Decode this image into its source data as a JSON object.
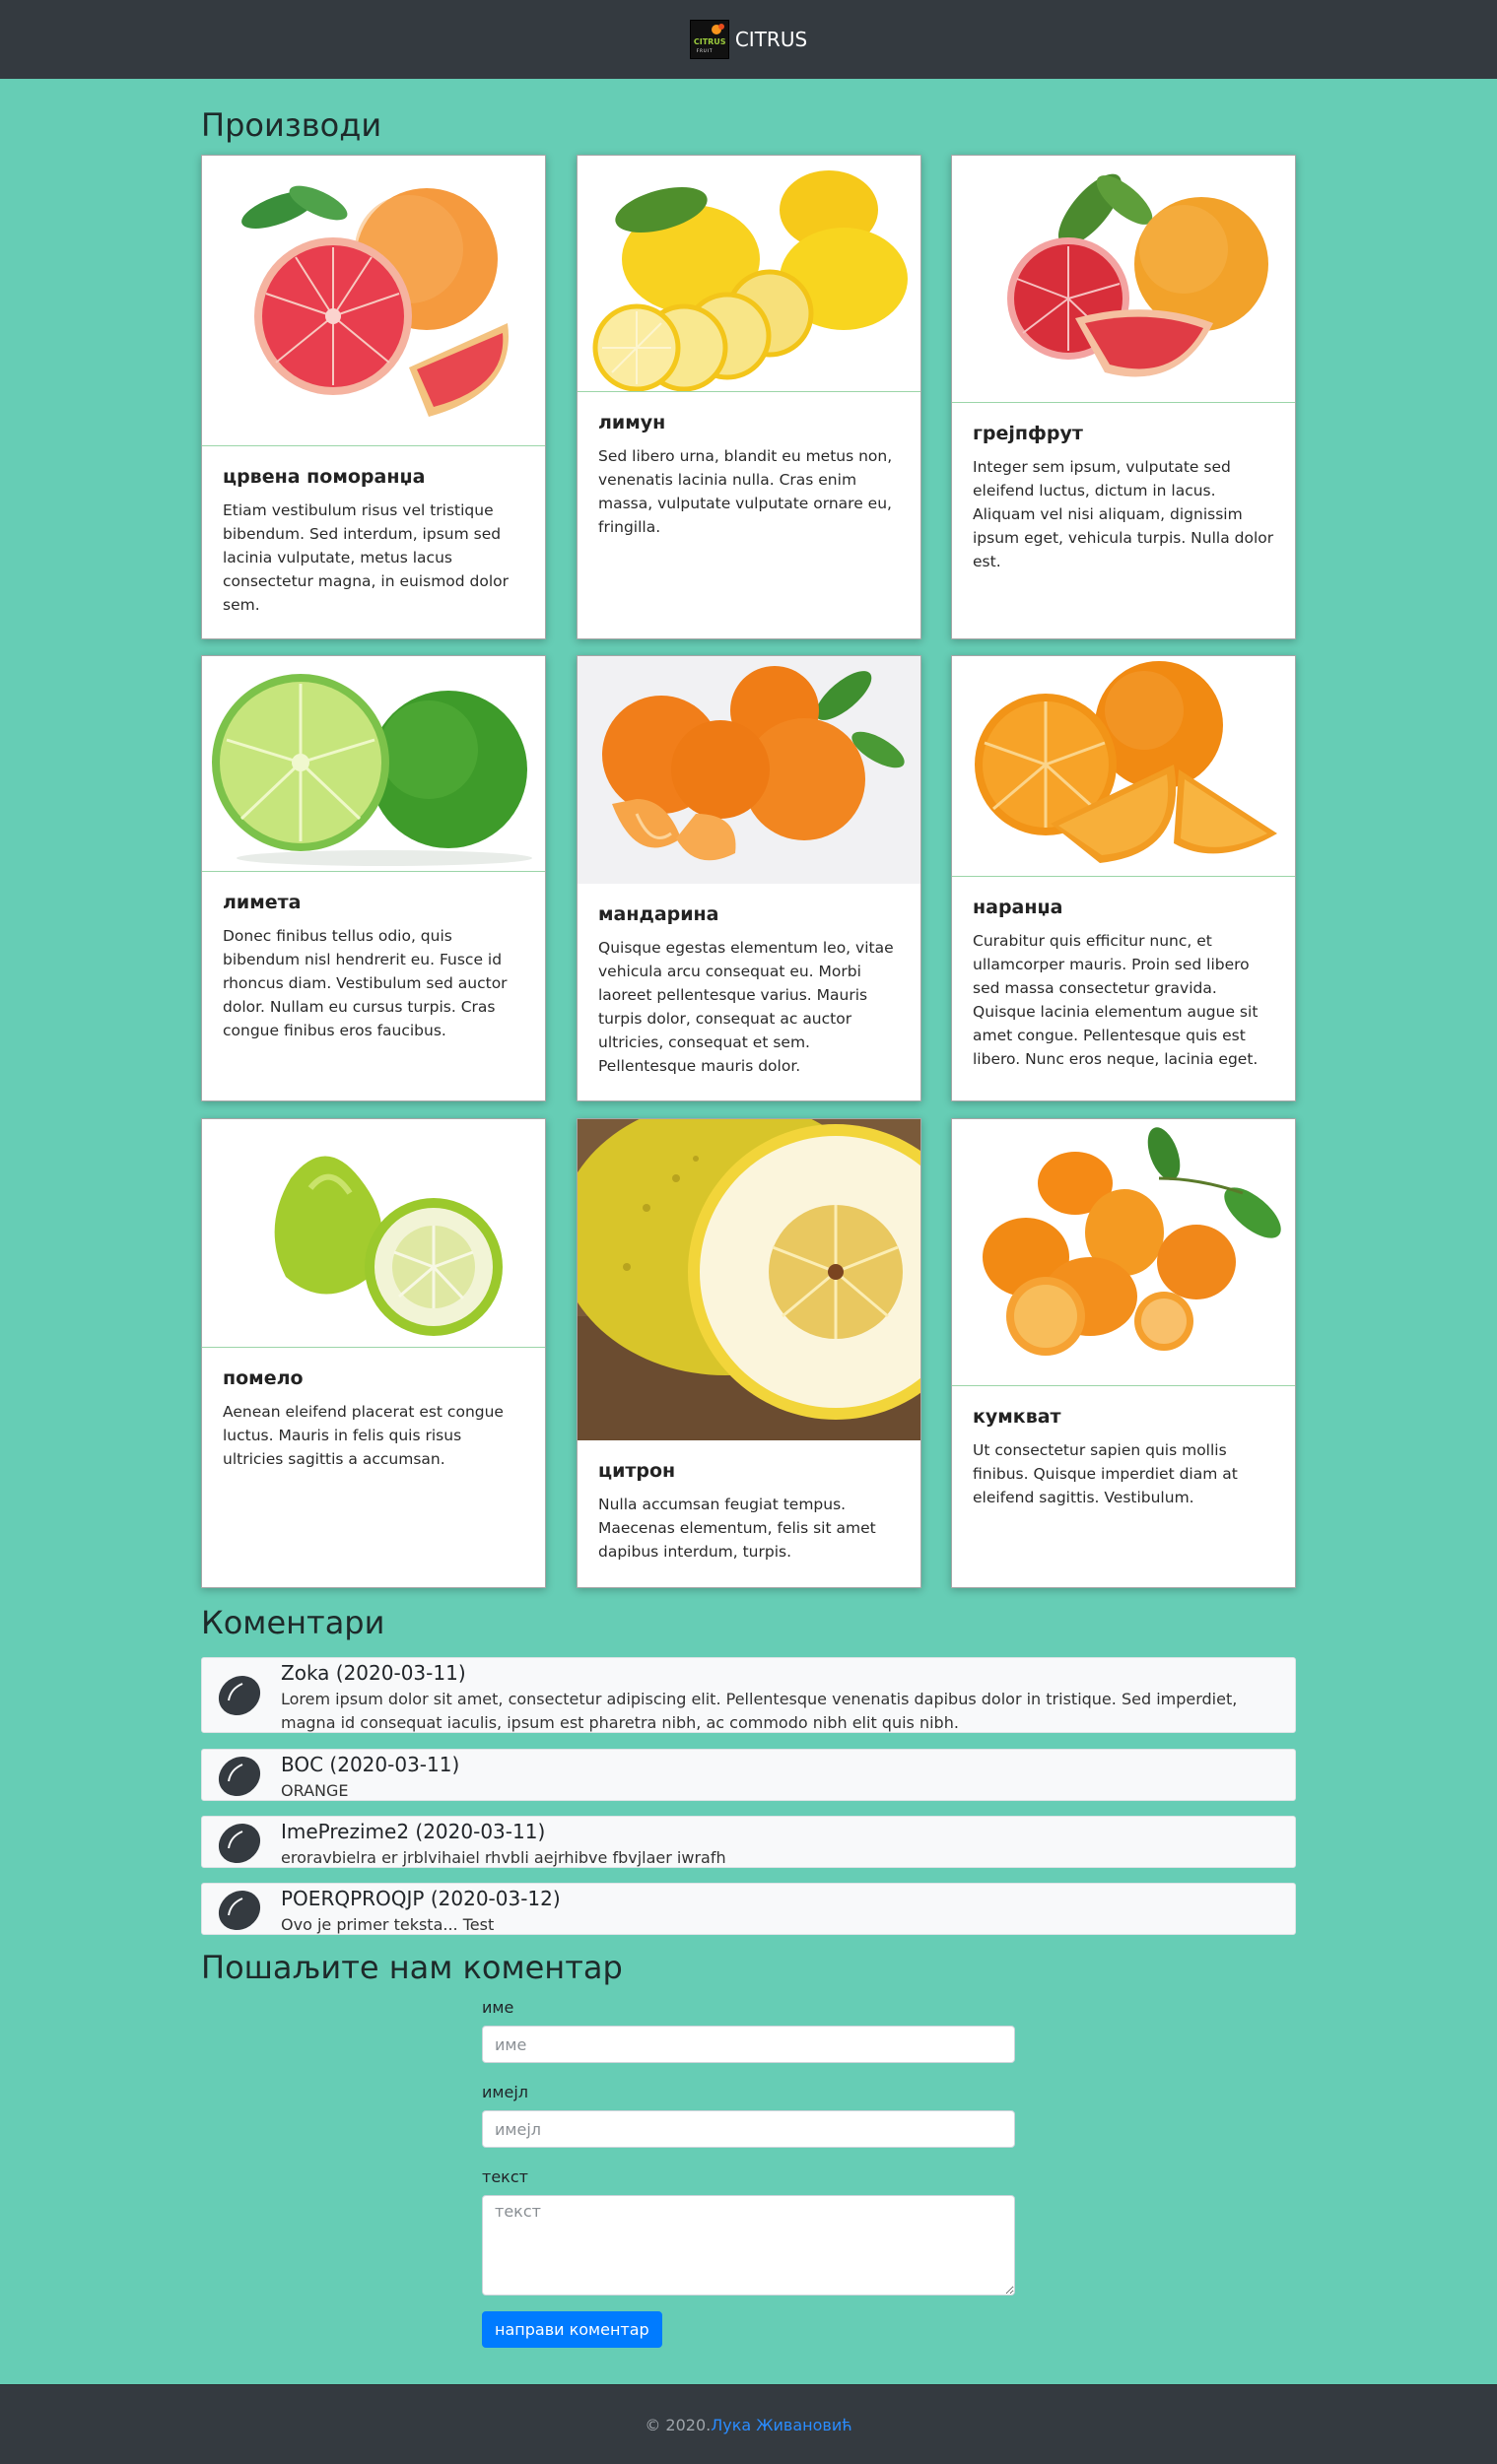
{
  "navbar": {
    "brand": "CITRUS",
    "logo_text": "CITRUS",
    "logo_subtext": "FRUIT"
  },
  "products": {
    "title": "Производи",
    "items": [
      {
        "name": "црвена поморанџа",
        "description": "Etiam vestibulum risus vel tristique bibendum. Sed interdum, ipsum sed lacinia vulputate, metus lacus consectetur magna, in euismod dolor sem.",
        "image": "red-orange-image"
      },
      {
        "name": "лимун",
        "description": "Sed libero urna, blandit eu metus non, venenatis lacinia nulla. Cras enim massa, vulputate vulputate ornare eu, fringilla.",
        "image": "lemon-image"
      },
      {
        "name": "грејпфрут",
        "description": "Integer sem ipsum, vulputate sed eleifend luctus, dictum in lacus. Aliquam vel nisi aliquam, dignissim ipsum eget, vehicula turpis. Nulla dolor est.",
        "image": "grapefruit-image"
      },
      {
        "name": "лимета",
        "description": "Donec finibus tellus odio, quis bibendum nisl hendrerit eu. Fusce id rhoncus diam. Vestibulum sed auctor dolor. Nullam eu cursus turpis. Cras congue finibus eros faucibus.",
        "image": "lime-image"
      },
      {
        "name": "мандарина",
        "description": "Quisque egestas elementum leo, vitae vehicula arcu consequat eu. Morbi laoreet pellentesque varius. Mauris turpis dolor, consequat ac auctor ultricies, consequat et sem. Pellentesque mauris dolor.",
        "image": "mandarin-image"
      },
      {
        "name": "наранџа",
        "description": "Curabitur quis efficitur nunc, et ullamcorper mauris. Proin sed libero sed massa consectetur gravida. Quisque lacinia elementum augue sit amet congue. Pellentesque quis est libero. Nunc eros neque, lacinia eget.",
        "image": "orange-image"
      },
      {
        "name": "помело",
        "description": "Aenean eleifend placerat est congue luctus. Mauris in felis quis risus ultricies sagittis a accumsan.",
        "image": "pomelo-image"
      },
      {
        "name": "цитрон",
        "description": "Nulla accumsan feugiat tempus. Maecenas elementum, felis sit amet dapibus interdum, turpis.",
        "image": "citron-image"
      },
      {
        "name": "кумкват",
        "description": "Ut consectetur sapien quis mollis finibus. Quisque imperdiet diam at eleifend sagittis. Vestibulum.",
        "image": "kumquat-image"
      }
    ]
  },
  "comments": {
    "title": "Коментари",
    "items": [
      {
        "author": "Zoka (2020-03-11)",
        "text": "Lorem ipsum dolor sit amet, consectetur adipiscing elit. Pellentesque venenatis dapibus dolor in tristique. Sed imperdiet, magna id consequat iaculis, ipsum est pharetra nibh, ac commodo nibh elit quis nibh."
      },
      {
        "author": "BOC (2020-03-11)",
        "text": "ORANGE"
      },
      {
        "author": "ImePrezime2 (2020-03-11)",
        "text": "eroravbielra er jrblvihaiel rhvbli aejrhibve fbvjlaer iwrafh"
      },
      {
        "author": "POERQPROQJP (2020-03-12)",
        "text": "Ovo je primer teksta... Test"
      }
    ]
  },
  "form": {
    "title": "Пошаљите нам коментар",
    "name_label": "име",
    "name_placeholder": "име",
    "email_label": "имејл",
    "email_placeholder": "имејл",
    "text_label": "текст",
    "text_placeholder": "текст",
    "submit_label": "направи коментар"
  },
  "footer": {
    "copyright": "© 2020.",
    "author": "Лука Живановић"
  },
  "colors": {
    "background": "#66cdb5",
    "navbar": "#343a40",
    "button": "#007bff",
    "link": "#2a8cff"
  }
}
